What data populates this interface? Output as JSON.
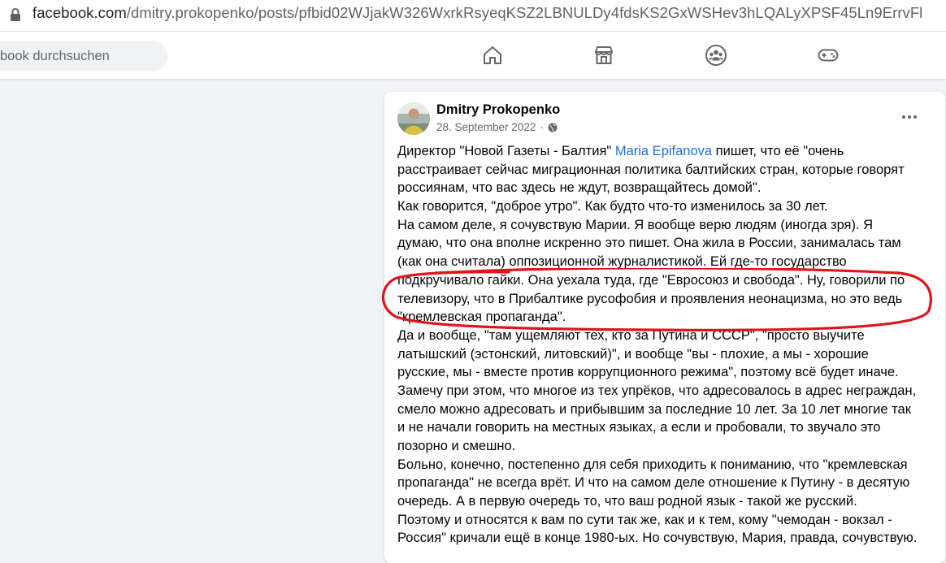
{
  "browser": {
    "url_host": "facebook.com",
    "url_path": "/dmitry.prokopenko/posts/pfbid02WJjakW326WxrkRsyeqKSZ2LBNULDy4fdsKS2GxWSHev3hLQALyXPSF45Ln9ErrvFl"
  },
  "nav": {
    "search_placeholder": "book durchsuchen",
    "icons": [
      "home-icon",
      "marketplace-icon",
      "groups-icon",
      "gaming-icon"
    ]
  },
  "post": {
    "author": "Dmitry Prokopenko",
    "date": "28. September 2022",
    "dot": "·",
    "privacy_icon": "globe-icon",
    "more_icon": "more-options-icon",
    "line0_pre": "Директор \"Новой Газеты - Балтия\" ",
    "mention": "Maria Epifanova",
    "line0_post": " пишет, что её \"очень",
    "lines": [
      "расстраивает сейчас миграционная политика балтийских стран, которые говорят",
      "россиянам, что вас здесь не ждут, возвращайтесь домой\".",
      "Как говорится, \"доброе утро\". Как будто что-то изменилось за 30 лет.",
      "На самом деле, я сочувствую Марии. Я вообще верю людям (иногда зря). Я",
      "думаю, что она вполне искренно это пишет. Она жила в России, занималась там",
      "(как она считала) оппозиционной журналистикой. Ей где-то государство",
      "подкручивало гайки. Она уехала туда, где \"Евросоюз и свобода\". Ну, говорили по",
      "телевизору, что в Прибалтике русофобия и проявления неонацизма, но это ведь",
      "\"кремлевская пропаганда\".",
      "Да и вообще, \"там ущемляют тех, кто за Путина и СССР\", \"просто выучите",
      "латышский (эстонский, литовский)\", и вообще \"вы - плохие, а мы - хорошие",
      "русские, мы - вместе против коррупционного режима\", поэтому всё будет иначе.",
      "Замечу при этом, что многое из тех упрёков, что адресовалось в адрес неграждан,",
      "смело можно адресовать и прибывшим за последние 10 лет. За 10 лет многие так",
      "и не начали говорить на местных языках, а если и пробовали, то звучало это",
      "позорно и смешно.",
      "Больно, конечно, постепенно для себя приходить к пониманию, что \"кремлевская",
      "пропаганда\" не всегда врёт. И что на самом деле отношение к Путину - в десятую",
      "очередь. А в первую очередь то, что ваш родной язык - такой же русский.",
      "Поэтому и относятся к вам по сути так же, как и к тем, кому \"чемодан - вокзал -",
      "Россия\" кричали ещё в конце 1980-ых. Но сочувствую, Мария, правда, сочувствую."
    ]
  },
  "annotation": {
    "color": "#e0141b"
  },
  "colors": {
    "link": "#216fdb",
    "secondary_text": "#65676b",
    "page_bg": "#f0f2f5"
  }
}
